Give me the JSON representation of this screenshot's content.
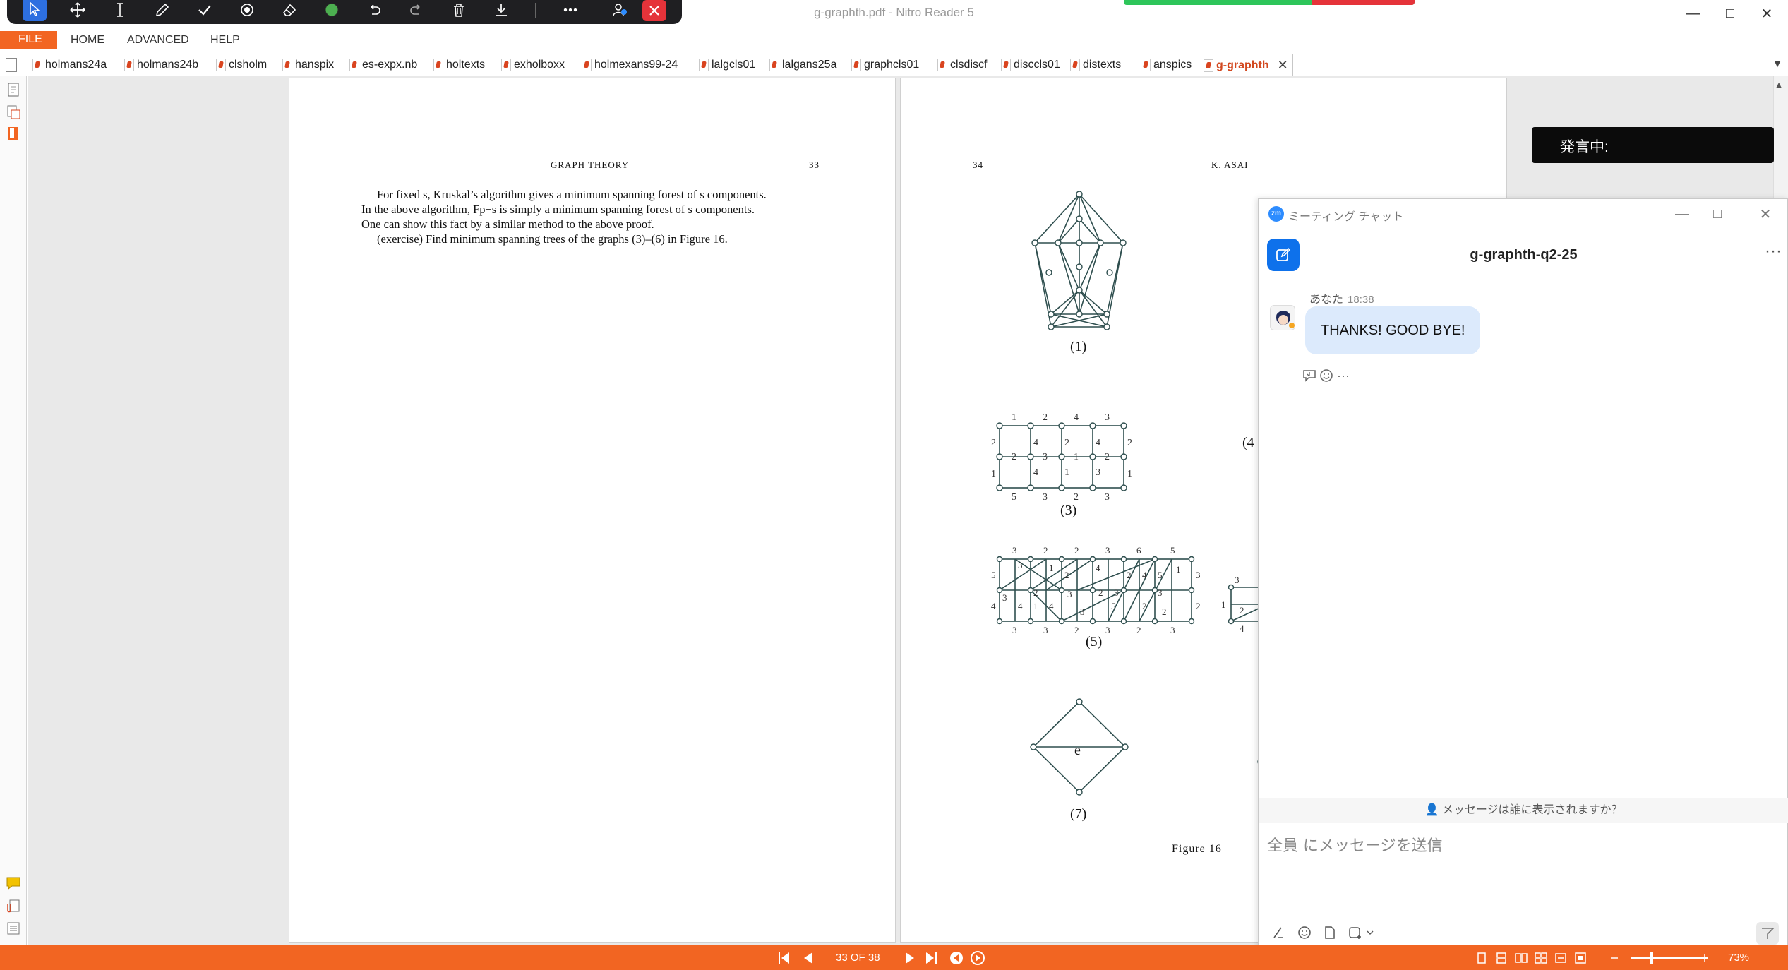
{
  "window": {
    "title": "g-graphth.pdf - Nitro Reader 5",
    "minimize": "—",
    "maximize": "□",
    "close": "✕"
  },
  "menu": {
    "file": "FILE",
    "items": [
      "HOME",
      "ADVANCED",
      "HELP"
    ]
  },
  "tabs": [
    {
      "label": "holmans24a"
    },
    {
      "label": "holmans24b"
    },
    {
      "label": "clsholm"
    },
    {
      "label": "hanspix"
    },
    {
      "label": "es-expx.nb"
    },
    {
      "label": "holtexts"
    },
    {
      "label": "exholboxx"
    },
    {
      "label": "holmexans99-24"
    },
    {
      "label": "lalgcls01"
    },
    {
      "label": "lalgans25a"
    },
    {
      "label": "graphcls01"
    },
    {
      "label": "clsdiscf"
    },
    {
      "label": "disccls01"
    },
    {
      "label": "distexts"
    },
    {
      "label": "anspics"
    },
    {
      "label": "g-graphth",
      "active": true
    }
  ],
  "page33": {
    "running_title": "GRAPH THEORY",
    "page_number": "33",
    "lines": [
      "For fixed s, Kruskal’s algorithm gives a minimum spanning forest of s components.",
      "In the above algorithm, Fp−s is simply a minimum spanning forest of s components.",
      "One can show this fact by a similar method to the above proof.",
      "(exercise) Find minimum spanning trees of the graphs (3)–(6) in Figure 16."
    ]
  },
  "page34": {
    "page_number": "34",
    "running_title": "K. ASAI",
    "captions": [
      "(1)",
      "(3)",
      "(5)",
      "(7)",
      "(4"
    ],
    "figure_caption": "Figure 16",
    "edge_label_e": "e",
    "grid3": {
      "top": [
        "1",
        "2",
        "4",
        "3"
      ],
      "left": [
        "2",
        "1"
      ],
      "right": [
        "2",
        "1"
      ],
      "bottom": [
        "5",
        "3",
        "2",
        "3"
      ],
      "inner_row1": [
        "4",
        "2",
        "4"
      ],
      "inner_row2": [
        "2",
        "3",
        "1",
        "2"
      ],
      "inner_row3": [
        "4",
        "1",
        "3"
      ]
    },
    "grid5": {
      "top": [
        "3",
        "2",
        "2",
        "3",
        "6",
        "5"
      ],
      "bottom": [
        "3",
        "3",
        "2",
        "3",
        "2",
        "3"
      ],
      "left": [
        "5",
        "4"
      ],
      "right": [
        "3",
        "2"
      ],
      "middle": [
        "3",
        "1",
        "2",
        "4",
        "2",
        "4",
        "5",
        "1",
        "3",
        "2",
        "3",
        "2",
        "3",
        "3",
        "2",
        "4",
        "1",
        "4",
        "3",
        "5",
        "2"
      ]
    },
    "partial_graph_labels": [
      "3",
      "1",
      "2",
      "4"
    ]
  },
  "speaking": {
    "label": "発言中:"
  },
  "chat": {
    "window_title": "ミーティング チャット",
    "conversation_name": "g-graphth-q2-25",
    "more": "···",
    "message": {
      "sender": "あなた",
      "time": "18:38",
      "text": "THANKS! GOOD BYE!"
    },
    "visibility_text": "メッセージは誰に表示されますか？",
    "input_placeholder": "全員 にメッセージを送信"
  },
  "status": {
    "page_indicator": "33 OF 38",
    "zoom": "73%"
  },
  "colors": {
    "accent_orange": "#f26522",
    "zoom_blue": "#0e71eb",
    "share_green": "#2ec55a",
    "share_red": "#e5333a",
    "graph_stroke": "#2f4f4f"
  }
}
